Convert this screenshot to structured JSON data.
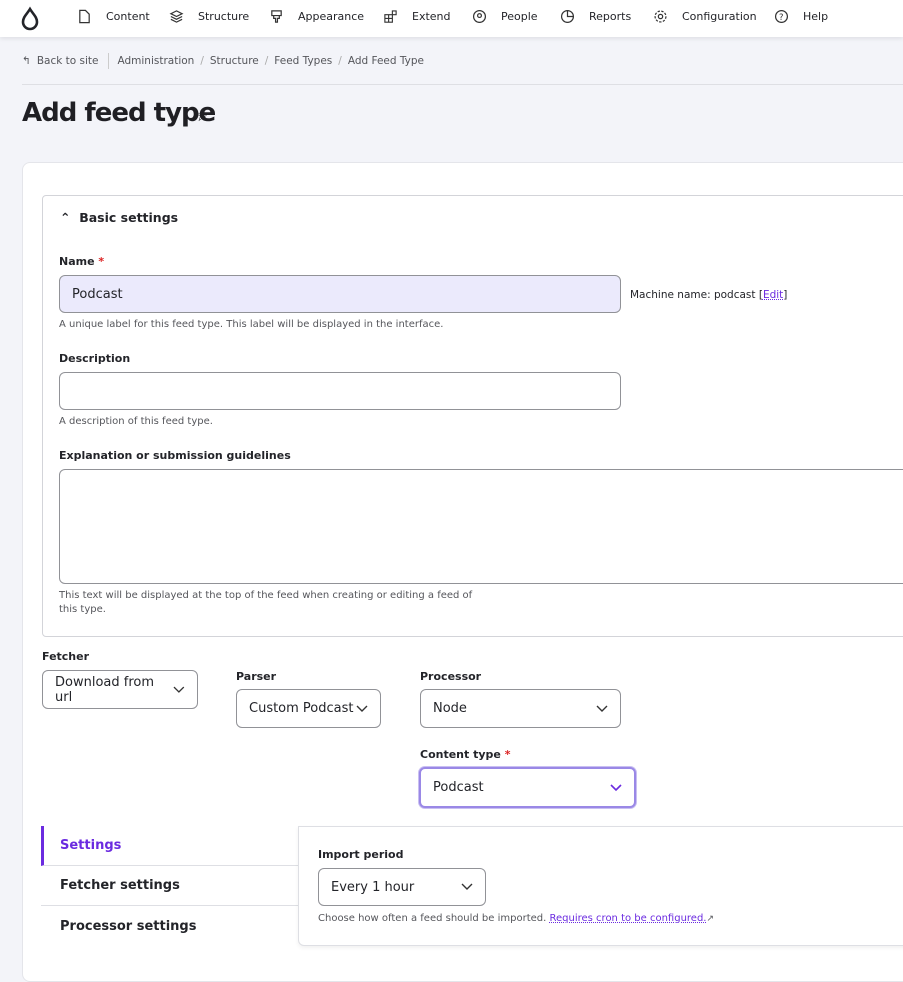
{
  "nav": {
    "items": [
      {
        "label": "Content",
        "icon": "file-icon"
      },
      {
        "label": "Structure",
        "icon": "layers-icon"
      },
      {
        "label": "Appearance",
        "icon": "brush-icon"
      },
      {
        "label": "Extend",
        "icon": "blocks-icon"
      },
      {
        "label": "People",
        "icon": "user-circle-icon"
      },
      {
        "label": "Reports",
        "icon": "pie-chart-icon"
      },
      {
        "label": "Configuration",
        "icon": "gear-icon"
      },
      {
        "label": "Help",
        "icon": "help-icon"
      }
    ]
  },
  "breadcrumb": {
    "back": "Back to site",
    "items": [
      "Administration",
      "Structure",
      "Feed Types",
      "Add Feed Type"
    ]
  },
  "page": {
    "title": "Add feed type"
  },
  "basic": {
    "summary": "Basic settings",
    "name_label": "Name",
    "name_value": "Podcast",
    "machine_name": "Machine name: podcast",
    "edit": "Edit",
    "name_desc": "A unique label for this feed type. This label will be displayed in the interface.",
    "description_label": "Description",
    "description_value": "",
    "description_desc": "A description of this feed type.",
    "help_label": "Explanation or submission guidelines",
    "help_value": "",
    "help_desc": "This text will be displayed at the top of the feed when creating or editing a feed of this type."
  },
  "plugins": {
    "fetcher_label": "Fetcher",
    "fetcher_value": "Download from url",
    "parser_label": "Parser",
    "parser_value": "Custom Podcast",
    "processor_label": "Processor",
    "processor_value": "Node",
    "content_type_label": "Content type",
    "content_type_value": "Podcast"
  },
  "vtabs": [
    "Settings",
    "Fetcher settings",
    "Processor settings"
  ],
  "settings": {
    "import_label": "Import period",
    "import_value": "Every 1 hour",
    "import_desc": "Choose how often a feed should be imported.",
    "cron_link": "Requires cron to be configured."
  },
  "colors": {
    "accent": "#6b2be0",
    "focus": "#9a88e6",
    "filled_bg": "#ebeafc"
  }
}
